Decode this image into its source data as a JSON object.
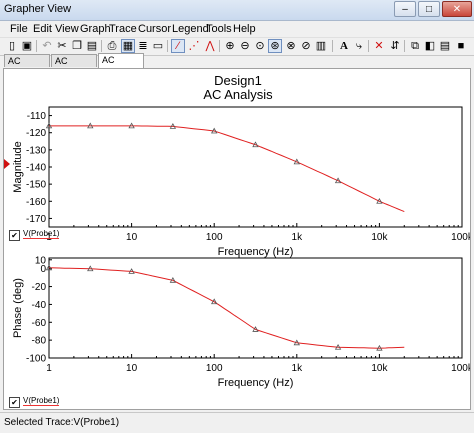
{
  "window": {
    "title": "Grapher View"
  },
  "menus": [
    "File",
    "Edit",
    "View",
    "Graph",
    "Trace",
    "Cursor",
    "Legend",
    "Tools",
    "Help"
  ],
  "toolbar_icons": [
    "new-icon",
    "save-icon",
    "undo-icon",
    "cut-icon",
    "copy-icon",
    "paste-icon",
    "print-icon",
    "print-preview-icon",
    "grid-icon",
    "show-legend-icon",
    "pointer-icon",
    "line-style-icon",
    "dot-style-icon",
    "mixed-style-icon",
    "zoom-in-icon",
    "zoom-out-icon",
    "zoom-fit-icon",
    "zoom-area-icon",
    "pan-icon",
    "properties-icon",
    "text-icon",
    "cursor-icon",
    "trace-icon",
    "cursor-mode-icon",
    "export-icon",
    "overlay-icon",
    "reverse-colors-icon",
    "export-excel-icon"
  ],
  "tabs": [
    "AC Analysis",
    "AC Analysis",
    "AC Analysis"
  ],
  "graph": {
    "title": "Design1",
    "subtitle": "AC Analysis",
    "trace_color": "#e02020",
    "magnitude": {
      "ylabel": "Magnitude",
      "xlabel": "Frequency (Hz)",
      "yticks": [
        "-110",
        "-120",
        "-130",
        "-140",
        "-150",
        "-160",
        "-170"
      ],
      "xticks": [
        "1",
        "10",
        "100",
        "1k",
        "10k",
        "100k"
      ],
      "legend": "V(Probe1)"
    },
    "phase": {
      "ylabel": "Phase (deg)",
      "xlabel": "Frequency (Hz)",
      "yticks": [
        "10",
        "0",
        "-20",
        "-40",
        "-60",
        "-80",
        "-100"
      ],
      "xticks": [
        "1",
        "10",
        "100",
        "1k",
        "10k",
        "100k"
      ],
      "legend": "V(Probe1)"
    }
  },
  "status": {
    "text": "Selected Trace:V(Probe1)"
  },
  "chart_data": [
    {
      "type": "line",
      "title": "Design1",
      "subtitle": "AC Analysis",
      "xlabel": "Frequency (Hz)",
      "ylabel": "Magnitude",
      "x_scale": "log",
      "xlim": [
        1,
        100000
      ],
      "ylim": [
        -175,
        -105
      ],
      "series": [
        {
          "name": "V(Probe1)",
          "x": [
            1,
            3.16,
            10,
            31.6,
            100,
            316,
            1000,
            3160,
            10000,
            20000
          ],
          "y": [
            -116,
            -116,
            -116,
            -116.3,
            -119,
            -127,
            -137,
            -148,
            -160,
            -166
          ]
        }
      ]
    },
    {
      "type": "line",
      "xlabel": "Frequency (Hz)",
      "ylabel": "Phase (deg)",
      "x_scale": "log",
      "xlim": [
        1,
        100000
      ],
      "ylim": [
        -100,
        12
      ],
      "series": [
        {
          "name": "V(Probe1)",
          "x": [
            1,
            3.16,
            10,
            31.6,
            100,
            316,
            1000,
            3160,
            10000,
            20000
          ],
          "y": [
            1,
            0,
            -3,
            -13,
            -37,
            -68,
            -83,
            -88,
            -89,
            -88
          ]
        }
      ]
    }
  ]
}
